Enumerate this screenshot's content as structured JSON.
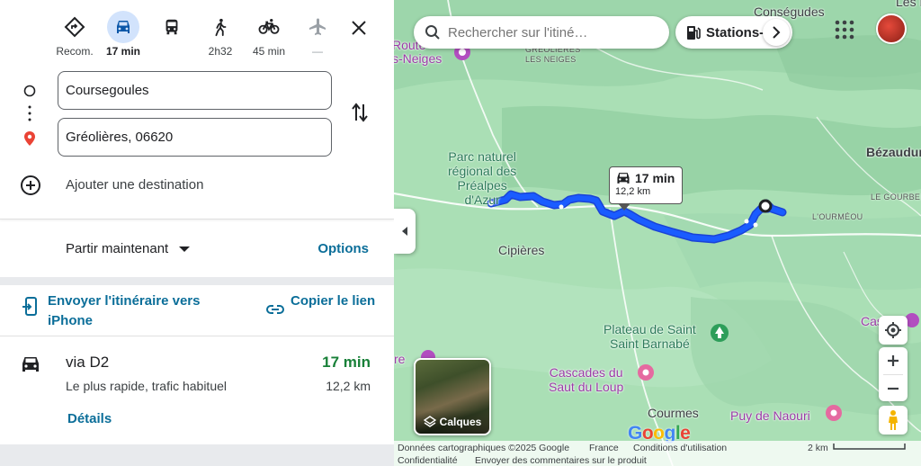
{
  "travel_modes": [
    {
      "name": "recommended",
      "icon": "directions-diamond-icon",
      "label": "Recom.",
      "active": false
    },
    {
      "name": "car",
      "icon": "car-icon",
      "label": "17 min",
      "active": true
    },
    {
      "name": "transit",
      "icon": "bus-icon",
      "label": "",
      "active": false
    },
    {
      "name": "walk",
      "icon": "walk-icon",
      "label": "2h32",
      "active": false
    },
    {
      "name": "bike",
      "icon": "bike-icon",
      "label": "45 min",
      "active": false
    },
    {
      "name": "flight",
      "icon": "plane-icon",
      "label": "—",
      "active": false
    }
  ],
  "waypoints": {
    "origin": "Coursegoules",
    "destination": "Gréolières, 06620",
    "add_label": "Ajouter une destination"
  },
  "depart": {
    "label": "Partir maintenant",
    "options_label": "Options"
  },
  "actions": {
    "send_label": "Envoyer l'itinéraire vers iPhone",
    "copy_label": "Copier le lien"
  },
  "route": {
    "via": "via D2",
    "description": "Le plus rapide, trafic habituel",
    "duration": "17 min",
    "distance": "12,2 km",
    "details_label": "Détails"
  },
  "map": {
    "search_placeholder": "Rechercher sur l'itiné…",
    "chip_label": "Stations-",
    "callout_duration": "17 min",
    "callout_distance": "12,2 km",
    "layers_label": "Calques",
    "labels": {
      "consegudes": "Conségudes",
      "route_top": "Route",
      "neiges": "s-Neiges",
      "greolieres_neiges_1": "GRÉOLIÈRES",
      "greolieres_neiges_2": "LES NEIGES",
      "parc": "Parc naturel\nrégional des\nPréalpes\nd'Azur",
      "cipieres": "Cipières",
      "plateau": "Plateau de Saint\nSaint Barnabé",
      "cascades": "Cascades du\nSaut du Loup",
      "courmes": "Courmes",
      "puy": "Puy de Naouri",
      "bezaudun": "Bézaudur",
      "gourbel": "LE GOURBEL",
      "ourmeou": "L'OURMÉOU",
      "les_f": "Les F",
      "cas": "Cas",
      "left_e": "re"
    },
    "logo": "Google",
    "footer": {
      "data": "Données cartographiques ©2025 Google",
      "country": "France",
      "terms": "Conditions d'utilisation",
      "privacy": "Confidentialité",
      "feedback": "Envoyer des commentaires sur le produit",
      "scale": "2 km"
    },
    "colors": {
      "route": "#1a5cff",
      "map_bg": "#aadfb5",
      "accent": "#0b6e99",
      "green_text": "#188038"
    }
  }
}
